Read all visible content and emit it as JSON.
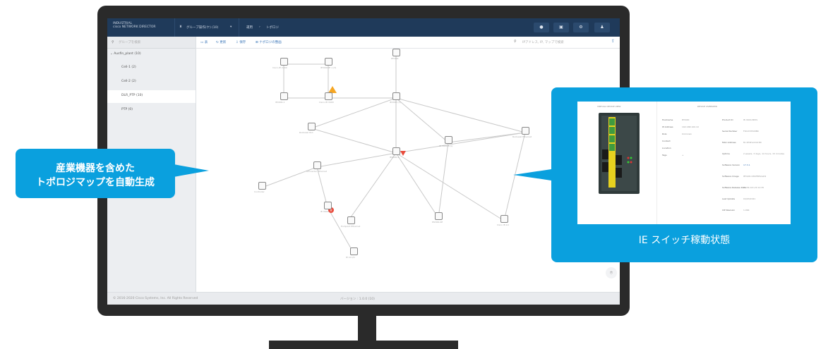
{
  "app": {
    "header": {
      "brand_line1": "INDUSTRIAL",
      "brand_line2": "cisco NETWORK DIRECTOR",
      "group": "グループ操作(ケ) (10)",
      "crumb1": "運用",
      "crumb2": "トポロジ",
      "alerts": "0"
    },
    "sidebar": {
      "search": "グループを検索",
      "root": "Ausfin_plant (10)",
      "items": [
        {
          "label": "Cell-1 (2)",
          "active": false
        },
        {
          "label": "Cell-2 (2)",
          "active": false
        },
        {
          "label": "DLR_PTP (10)",
          "active": true
        },
        {
          "label": "PTP (0)",
          "active": false
        }
      ]
    },
    "toolbar": {
      "view": "表",
      "refresh": "更新",
      "save": "保存",
      "layout": "ナポロジの整画",
      "search": "IPアドレス, IP, マップで検索"
    },
    "nodes": [
      {
        "label": "Cisco-IE-3400"
      },
      {
        "label": "IE3400-IE 1 (3)"
      },
      {
        "label": "IE3300"
      },
      {
        "label": "IE4000-1"
      },
      {
        "label": "Cisco-IE-3400"
      },
      {
        "label": "IE2000 (1)"
      },
      {
        "label": "Rockwell PLC"
      },
      {
        "label": "IE-3400-8 (L)"
      },
      {
        "label": "Rockwell Ethernet"
      },
      {
        "label": "IE4000-2"
      },
      {
        "label": "Schneider Ethernet"
      },
      {
        "label": "Controller"
      },
      {
        "label": "IE-3400"
      },
      {
        "label": "IE2000-4E"
      },
      {
        "label": "Cisco IE-10"
      },
      {
        "label": "IE 10 I/O"
      },
      {
        "label": "Endpoint Ethernet"
      }
    ],
    "footer": {
      "copyright": "© 2016-2020 Cisco Systems, Inc. All Rights Reserved",
      "version": "バージョン : 1.0.0 (10)"
    }
  },
  "callout_left": {
    "line1": "産業機器を含めた",
    "line2": "トポロジマップを自動生成"
  },
  "callout_right": {
    "caption": "IE スイッチ稼動状態",
    "panel_left_title": "VIRTUAL DEVICE VIEW",
    "panel_right_title": "DEVICE OVERVIEW",
    "fields_a": [
      {
        "k": "Hostname",
        "v": "IE3400"
      },
      {
        "k": "IP Address",
        "v": "192.168.100.10"
      },
      {
        "k": "Role",
        "v": "Unknown"
      },
      {
        "k": "Contact",
        "v": ""
      },
      {
        "k": "Location",
        "v": ""
      },
      {
        "k": "Tags",
        "v": "+"
      }
    ],
    "fields_b": [
      {
        "k": "Product ID",
        "v": "IE-3400-8P2S"
      },
      {
        "k": "Serial Number",
        "v": "FOC2335X0BK"
      },
      {
        "k": "MAC Address",
        "v": "8c:0f:6f:a4:b0:80"
      },
      {
        "k": "Uptime",
        "v": "2 weeks, 3 days, 14 hours, 15 minutes"
      },
      {
        "k": "Software Version",
        "v": "17.3.1"
      },
      {
        "k": "Software Image",
        "v": "IE3x00-UNIVERSALK9"
      },
      {
        "k": "Software Release Date",
        "v": "Fri 09-Oct-20 12:35"
      },
      {
        "k": "Last Update",
        "v": "04/03/2021"
      },
      {
        "k": "CIP Revision",
        "v": "1.064"
      }
    ]
  },
  "colors": {
    "accent": "#0aa0de",
    "header": "#1f3a5a",
    "warning": "#f5a623",
    "error": "#e84b3c"
  }
}
